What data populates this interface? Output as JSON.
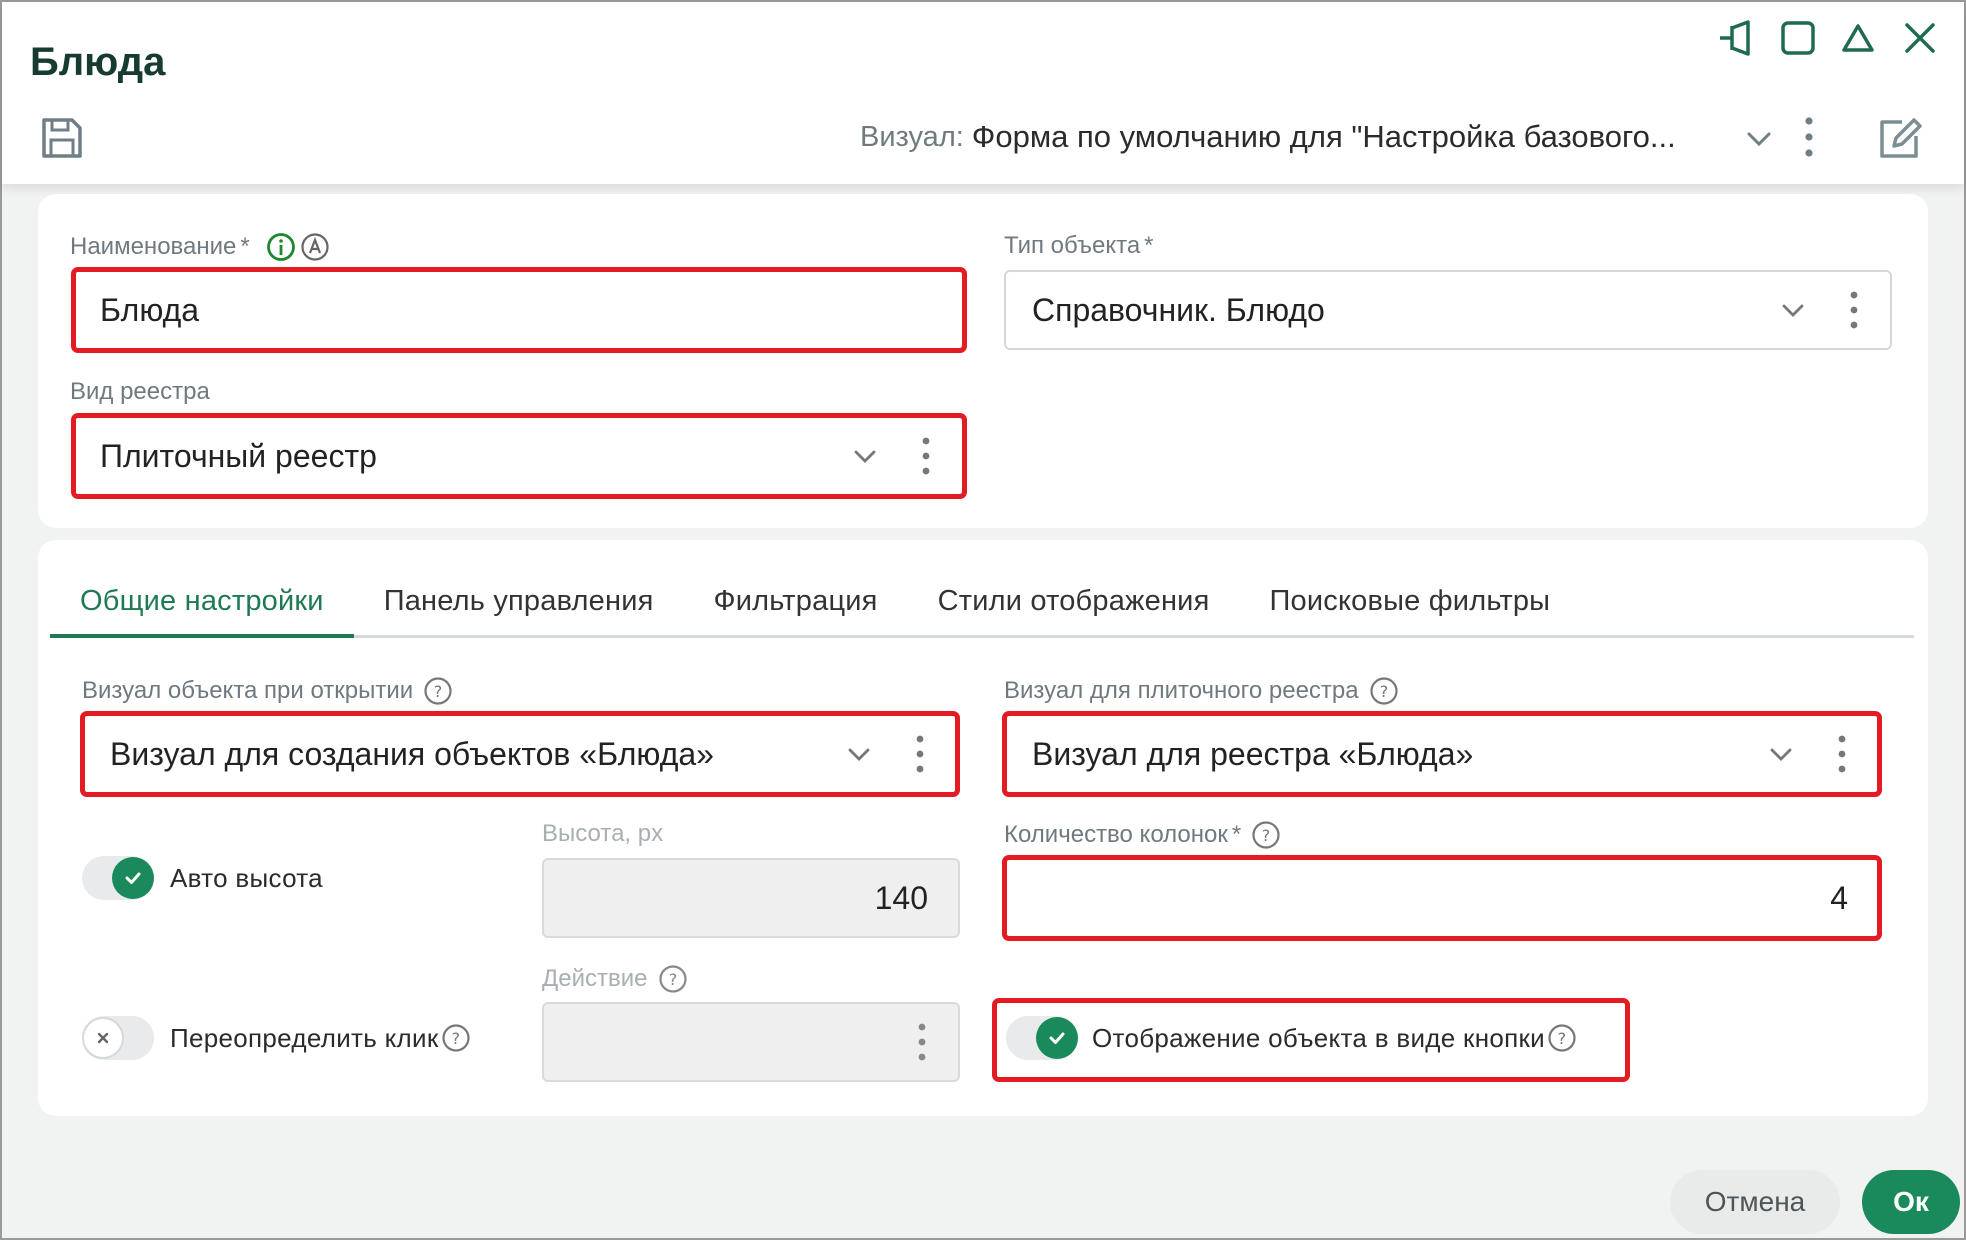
{
  "window": {
    "title": "Блюда",
    "controls": [
      "pin-icon",
      "maximize-icon",
      "collapse-icon",
      "close-icon"
    ]
  },
  "toolbar": {
    "visual_label": "Визуал:",
    "visual_value": "Форма по умолчанию для \"Настройка базового...",
    "save_icon": "save-icon",
    "edit_icon": "edit-icon"
  },
  "form": {
    "name": {
      "label": "Наименование",
      "required": "*",
      "value": "Блюда"
    },
    "object_type": {
      "label": "Тип объекта",
      "required": "*",
      "value": "Справочник. Блюдо"
    },
    "registry_view": {
      "label": "Вид реестра",
      "value": "Плиточный реестр"
    }
  },
  "tabs": [
    {
      "label": "Общие настройки",
      "active": true
    },
    {
      "label": "Панель управления",
      "active": false
    },
    {
      "label": "Фильтрация",
      "active": false
    },
    {
      "label": "Стили отображения",
      "active": false
    },
    {
      "label": "Поисковые фильтры",
      "active": false
    }
  ],
  "general": {
    "visual_open": {
      "label": "Визуал объекта при открытии",
      "value": "Визуал для создания объектов «Блюда»"
    },
    "visual_tile": {
      "label": "Визуал для плиточного реестра",
      "value": "Визуал для реестра «Блюда»"
    },
    "auto_height": {
      "label": "Авто высота",
      "on": true
    },
    "height": {
      "label": "Высота, px",
      "value": "140"
    },
    "columns": {
      "label": "Количество колонок",
      "required": "*",
      "value": "4"
    },
    "override_click": {
      "label": "Переопределить клик",
      "on": false
    },
    "action": {
      "label": "Действие",
      "value": ""
    },
    "button_display": {
      "label": "Отображение объекта в виде кнопки",
      "on": true
    }
  },
  "footer": {
    "cancel": "Отмена",
    "ok": "Ок"
  },
  "colors": {
    "accent": "#1a8a5c",
    "title": "#173b33",
    "highlight": "#e31b23"
  }
}
